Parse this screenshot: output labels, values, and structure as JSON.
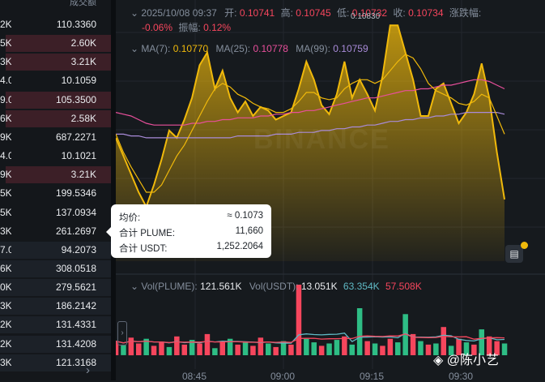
{
  "orderbook": {
    "col_header": "成交额",
    "rows": [
      {
        "a": "2K",
        "b": "110.3360",
        "t": "sell",
        "w": 0.0
      },
      {
        "a": "5K",
        "b": "2.60K",
        "t": "sell",
        "w": 0.95
      },
      {
        "a": "3K",
        "b": "3.21K",
        "t": "sell",
        "w": 0.95
      },
      {
        "a": "4.0",
        "b": "10.1059",
        "t": "sell",
        "w": 0.0
      },
      {
        "a": "9.0",
        "b": "105.3500",
        "t": "sell",
        "w": 0.95
      },
      {
        "a": "6K",
        "b": "2.58K",
        "t": "sell",
        "w": 0.95
      },
      {
        "a": "9K",
        "b": "687.2271",
        "t": "sell",
        "w": 0.0
      },
      {
        "a": "4.0",
        "b": "10.1021",
        "t": "sell",
        "w": 0.0
      },
      {
        "a": "9K",
        "b": "3.21K",
        "t": "sell",
        "w": 0.95
      },
      {
        "a": "5K",
        "b": "199.5346",
        "t": "sell",
        "w": 0.0
      },
      {
        "a": "5K",
        "b": "137.0934",
        "t": "sell",
        "w": 0.0
      },
      {
        "a": "3K",
        "b": "261.2697",
        "t": "sell",
        "w": 0.0
      },
      {
        "a": "7.0",
        "b": "94.2073",
        "t": "buy",
        "w": 0.95
      },
      {
        "a": "6K",
        "b": "308.0518",
        "t": "buy",
        "w": 0.95
      },
      {
        "a": "0K",
        "b": "279.5621",
        "t": "buy",
        "w": 0.95
      },
      {
        "a": "3K",
        "b": "186.2142",
        "t": "buy",
        "w": 0.95
      },
      {
        "a": "2K",
        "b": "131.4331",
        "t": "buy",
        "w": 0.95
      },
      {
        "a": "2K",
        "b": "131.4208",
        "t": "buy",
        "w": 0.95
      },
      {
        "a": "3K",
        "b": "121.3168",
        "t": "buy",
        "w": 0.95
      }
    ],
    "more_arrow": "›"
  },
  "candle_info": {
    "date": "2025/10/08 09:37",
    "open_label": "开:",
    "open": "0.10741",
    "high_label": "高:",
    "high": "0.10745",
    "low_label": "低:",
    "low": "0.10732",
    "close_label": "收:",
    "close": "0.10734",
    "change_label": "涨跌幅:",
    "change": "-0.06%",
    "amp_label": "振幅:",
    "amp": "0.12%"
  },
  "ma": {
    "ma7_label": "MA(7):",
    "ma7": "0.10770",
    "ma25_label": "MA(25):",
    "ma25": "0.10778",
    "ma99_label": "MA(99):",
    "ma99": "0.10759"
  },
  "high_marker": "0.10830",
  "watermark": "BINANCE",
  "tooltip": {
    "avg_label": "均价:",
    "avg": "≈ 0.1073",
    "qty_label": "合计 PLUME:",
    "qty": "11,660",
    "usdt_label": "合计 USDT:",
    "usdt": "1,252.2064"
  },
  "vol": {
    "plume_label": "Vol(PLUME):",
    "plume": "121.561K",
    "usdt_label": "Vol(USDT):",
    "usdt": "13.051K",
    "ma_a": "63.354K",
    "ma_b": "57.508K"
  },
  "time_axis": [
    "08:45",
    "09:00",
    "09:15",
    "09:30"
  ],
  "user_watermark": "@陈小艺",
  "colors": {
    "up": "#2ebd85",
    "down": "#f6465d",
    "line": "#f0b90b",
    "ma25": "#e84f9b",
    "ma99": "#a98bd9"
  },
  "chart_data": {
    "type": "area",
    "price_line": [
      0.10768,
      0.10758,
      0.10748,
      0.10738,
      0.1073,
      0.10742,
      0.10756,
      0.10772,
      0.10768,
      0.10778,
      0.1079,
      0.10808,
      0.10815,
      0.10795,
      0.10805,
      0.1079,
      0.10782,
      0.10788,
      0.1078,
      0.10785,
      0.10783,
      0.10778,
      0.1078,
      0.10782,
      0.10795,
      0.1081,
      0.108,
      0.10786,
      0.10781,
      0.10792,
      0.1081,
      0.1079,
      0.108,
      0.10792,
      0.10783,
      0.10802,
      0.1083,
      0.1083,
      0.10815,
      0.108,
      0.1078,
      0.1078,
      0.10795,
      0.10798,
      0.10787,
      0.10776,
      0.10782,
      0.10792,
      0.10809,
      0.1079,
      0.1076,
      0.10734
    ],
    "ma7": [
      0.1077,
      0.1076,
      0.10752,
      0.10745,
      0.10738,
      0.10738,
      0.10742,
      0.1075,
      0.10758,
      0.10764,
      0.10772,
      0.1078,
      0.10788,
      0.10795,
      0.10798,
      0.10796,
      0.10792,
      0.1079,
      0.10787,
      0.10785,
      0.10784,
      0.10782,
      0.10782,
      0.10784,
      0.10788,
      0.10793,
      0.10793,
      0.1079,
      0.10789,
      0.1079,
      0.10795,
      0.10798,
      0.108,
      0.108,
      0.10798,
      0.108,
      0.10805,
      0.1081,
      0.10814,
      0.10812,
      0.10806,
      0.10798,
      0.10794,
      0.10792,
      0.1079,
      0.10787,
      0.10786,
      0.10788,
      0.10792,
      0.1079,
      0.1078,
      0.1077
    ],
    "ma25": [
      0.10782,
      0.10781,
      0.1078,
      0.10778,
      0.10776,
      0.10775,
      0.10775,
      0.10775,
      0.10775,
      0.10775,
      0.10776,
      0.10776,
      0.10777,
      0.10777,
      0.10778,
      0.10778,
      0.10779,
      0.10779,
      0.10779,
      0.1078,
      0.1078,
      0.10781,
      0.10781,
      0.10782,
      0.10782,
      0.10783,
      0.10783,
      0.10784,
      0.10785,
      0.10786,
      0.10787,
      0.10788,
      0.10789,
      0.1079,
      0.1079,
      0.10791,
      0.10792,
      0.10793,
      0.10794,
      0.10794,
      0.10795,
      0.10795,
      0.10796,
      0.10797,
      0.10797,
      0.10798,
      0.10799,
      0.108,
      0.108,
      0.10799,
      0.10797,
      0.10795
    ],
    "ma99": [
      0.1077,
      0.1077,
      0.10769,
      0.10769,
      0.10768,
      0.10768,
      0.10768,
      0.10768,
      0.10768,
      0.10768,
      0.10768,
      0.10768,
      0.10768,
      0.10768,
      0.10768,
      0.10768,
      0.10769,
      0.10769,
      0.10769,
      0.10769,
      0.10769,
      0.1077,
      0.1077,
      0.1077,
      0.10771,
      0.10771,
      0.10771,
      0.10772,
      0.10772,
      0.10773,
      0.10773,
      0.10774,
      0.10774,
      0.10775,
      0.10775,
      0.10776,
      0.10777,
      0.10777,
      0.10778,
      0.10778,
      0.10779,
      0.10779,
      0.1078,
      0.1078,
      0.10781,
      0.10781,
      0.10782,
      0.10782,
      0.10782,
      0.10782,
      0.10782,
      0.10781
    ],
    "volumes": [
      12,
      9,
      15,
      10,
      14,
      8,
      11,
      7,
      16,
      9,
      13,
      10,
      18,
      6,
      12,
      14,
      9,
      11,
      8,
      15,
      10,
      7,
      12,
      9,
      60,
      14,
      11,
      8,
      10,
      13,
      16,
      9,
      40,
      12,
      10,
      8,
      14,
      11,
      35,
      18,
      12,
      9,
      10,
      24,
      8,
      14,
      11,
      9,
      22,
      16,
      12,
      10
    ],
    "vol_dir": [
      "d",
      "u",
      "d",
      "d",
      "u",
      "d",
      "d",
      "u",
      "d",
      "d",
      "u",
      "d",
      "d",
      "u",
      "d",
      "u",
      "d",
      "u",
      "d",
      "d",
      "u",
      "d",
      "u",
      "d",
      "d",
      "u",
      "u",
      "d",
      "u",
      "u",
      "d",
      "u",
      "u",
      "d",
      "u",
      "d",
      "d",
      "u",
      "u",
      "d",
      "u",
      "d",
      "u",
      "d",
      "u",
      "d",
      "u",
      "d",
      "u",
      "d",
      "d",
      "u"
    ]
  }
}
